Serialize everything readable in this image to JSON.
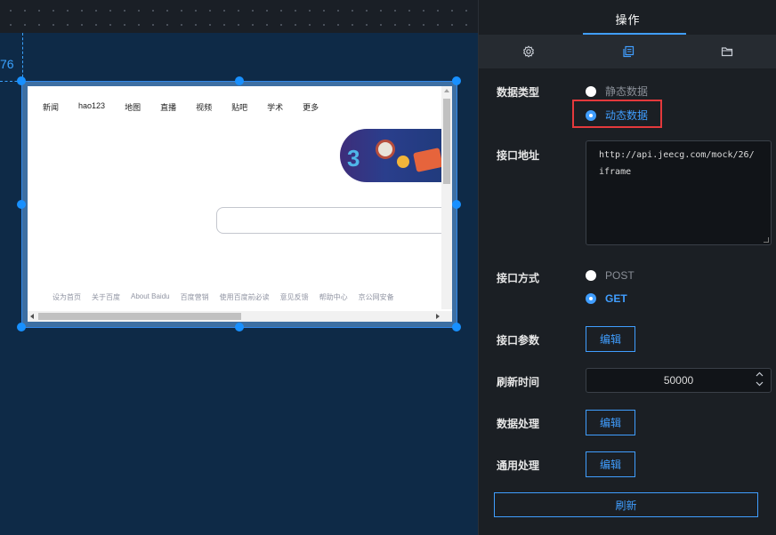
{
  "canvas": {
    "ruler_value": "76"
  },
  "browser": {
    "nav_items": [
      "新闻",
      "hao123",
      "地图",
      "直播",
      "视频",
      "贴吧",
      "学术",
      "更多"
    ],
    "footer_links": [
      "设为首页",
      "关于百度",
      "About Baidu",
      "百度营销",
      "使用百度前必读",
      "意见反馈",
      "帮助中心",
      "京公网安备"
    ]
  },
  "panel": {
    "title": "操作",
    "tabs": [
      "settings-icon",
      "copy-icon",
      "folder-icon"
    ],
    "data_type": {
      "label": "数据类型",
      "options": [
        "静态数据",
        "动态数据"
      ],
      "selected": "动态数据"
    },
    "api_url": {
      "label": "接口地址",
      "value": "http://api.jeecg.com/mock/26/iframe"
    },
    "api_method": {
      "label": "接口方式",
      "options": [
        "POST",
        "GET"
      ],
      "selected": "GET"
    },
    "api_params": {
      "label": "接口参数",
      "button": "编辑"
    },
    "refresh_time": {
      "label": "刷新时间",
      "value": "50000"
    },
    "data_processing": {
      "label": "数据处理",
      "button": "编辑"
    },
    "general_processing": {
      "label": "通用处理",
      "button": "编辑"
    },
    "refresh_button": "刷新"
  },
  "colors": {
    "accent": "#409eff",
    "highlight": "#e4393c",
    "canvas_bg": "#0e2a47",
    "panel_bg": "#1b1f24"
  }
}
